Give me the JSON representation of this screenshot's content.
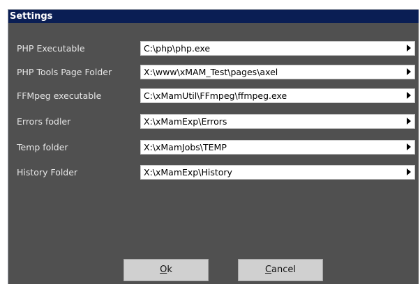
{
  "window": {
    "title": "Settings"
  },
  "fields": [
    {
      "label": "PHP Executable",
      "value": "C:\\php\\php.exe"
    },
    {
      "label": "PHP Tools Page Folder",
      "value": "X:\\www\\xMAM_Test\\pages\\axel"
    },
    {
      "label": "FFMpeg executable",
      "value": "C:\\xMamUtil\\FFmpeg\\ffmpeg.exe"
    },
    {
      "label": "Errors fodler",
      "value": "X:\\xMamExp\\Errors"
    },
    {
      "label": "Temp folder",
      "value": "X:\\xMamJobs\\TEMP"
    },
    {
      "label": "History Folder",
      "value": "X:\\xMamExp\\History"
    }
  ],
  "buttons": {
    "ok": {
      "mnemonic": "O",
      "rest": "k"
    },
    "cancel": {
      "mnemonic": "C",
      "rest": "ancel"
    }
  },
  "colors": {
    "titlebar": "#0a1e54",
    "body": "#505050",
    "button": "#d0d0d0"
  },
  "icons": {
    "field_browse": "triangle-right-icon"
  }
}
